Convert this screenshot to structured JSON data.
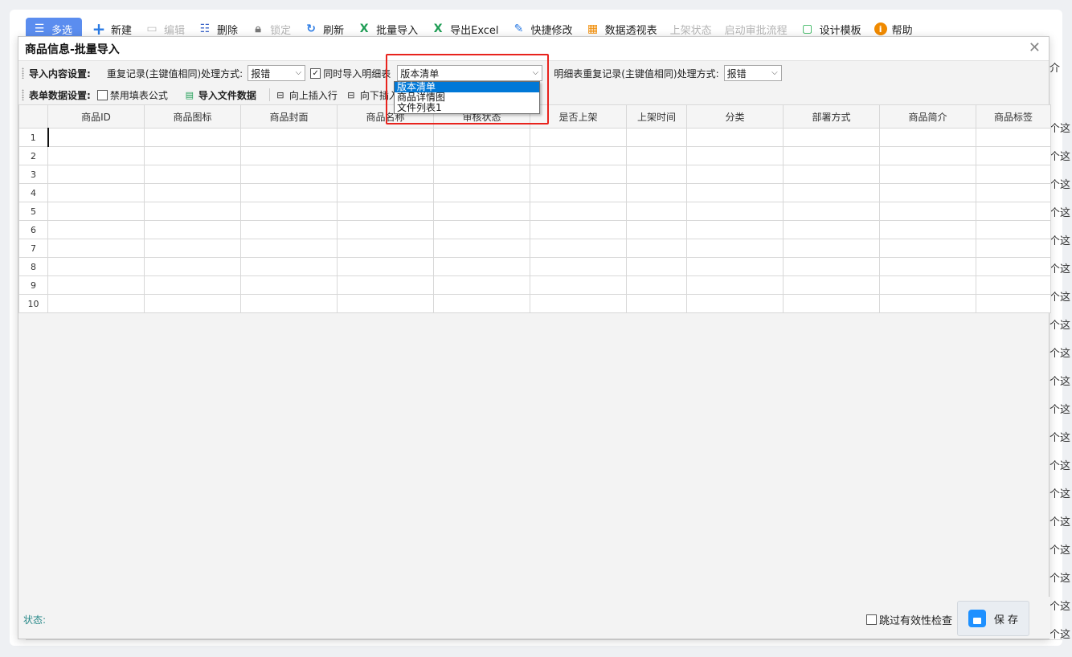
{
  "toolbar": {
    "items": [
      {
        "label": "多选",
        "icon": "list-icon"
      },
      {
        "label": "新建",
        "icon": "plus-icon"
      },
      {
        "label": "编辑",
        "icon": "edit-folder-icon"
      },
      {
        "label": "删除",
        "icon": "delete-icon"
      },
      {
        "label": "锁定",
        "icon": "lock-icon"
      },
      {
        "label": "刷新",
        "icon": "refresh-icon"
      },
      {
        "label": "批量导入",
        "icon": "excel-import-icon"
      },
      {
        "label": "导出Excel",
        "icon": "excel-export-icon"
      },
      {
        "label": "快捷修改",
        "icon": "pencil-icon"
      },
      {
        "label": "数据透视表",
        "icon": "pivot-icon"
      },
      {
        "label": "上架状态",
        "icon": ""
      },
      {
        "label": "启动审批流程",
        "icon": ""
      },
      {
        "label": "设计模板",
        "icon": "design-icon"
      },
      {
        "label": "帮助",
        "icon": "info-icon"
      }
    ]
  },
  "background": {
    "right_col_header": "介",
    "right_col_cell": "个这"
  },
  "modal": {
    "title": "商品信息-批量导入",
    "close_glyph": "✕",
    "import_settings_label": "导入内容设置:",
    "dup_label": "重复记录(主键值相同)处理方式:",
    "dup_value": "报错",
    "also_import_detail_label": "同时导入明细表",
    "detail_table_value": "版本清单",
    "detail_dup_label": "明细表重复记录(主键值相同)处理方式:",
    "detail_dup_value": "报错",
    "form_settings_label": "表单数据设置:",
    "disable_formula_label": "禁用填表公式",
    "import_file_label": "导入文件数据",
    "insert_up_label": "向上插入行",
    "insert_down_label": "向下插入行",
    "dropdown_options": [
      "版本清单",
      "商品详情图",
      "文件列表1"
    ],
    "columns": [
      "商品ID",
      "商品图标",
      "商品封面",
      "商品名称",
      "审核状态",
      "是否上架",
      "上架时间",
      "分类",
      "部署方式",
      "商品简介",
      "商品标签"
    ],
    "rows": [
      "1",
      "2",
      "3",
      "4",
      "5",
      "6",
      "7",
      "8",
      "9",
      "10"
    ],
    "status_label": "状态:",
    "skip_check_label": "跳过有效性检查",
    "save_label": "保 存"
  }
}
